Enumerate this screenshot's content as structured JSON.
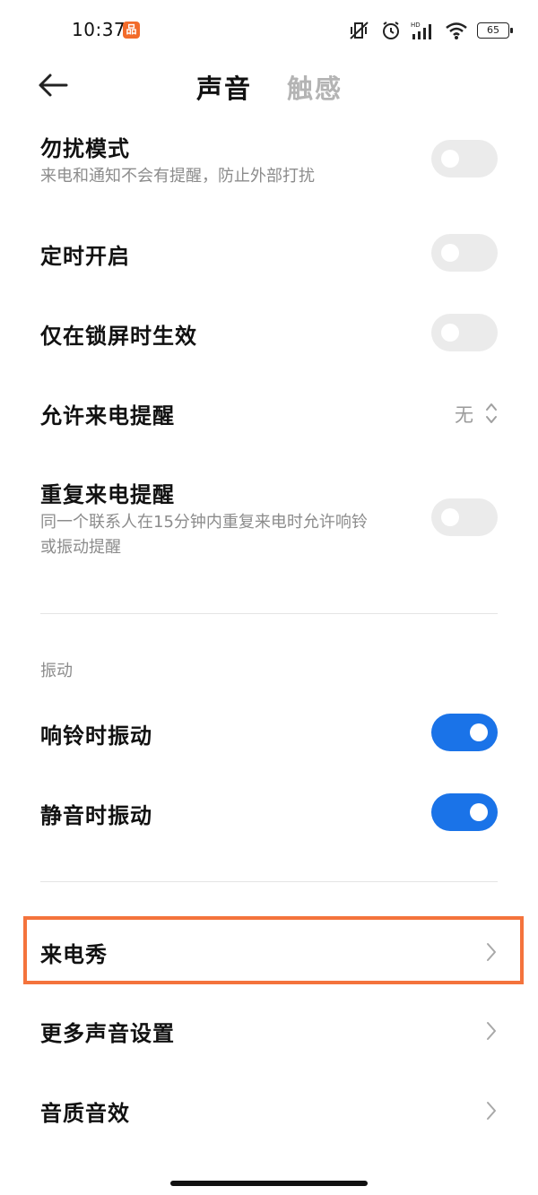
{
  "status_bar": {
    "time": "10:37",
    "app_badge": "品",
    "battery": "65",
    "icons": [
      "mute-vibrate-icon",
      "alarm-icon",
      "hd-signal-icon",
      "wifi-icon",
      "battery-icon"
    ]
  },
  "header": {
    "tab_active": "声音",
    "tab_inactive": "触感"
  },
  "dnd": {
    "title": "勿扰模式",
    "subtitle": "来电和通知不会有提醒，防止外部打扰",
    "enabled": false
  },
  "scheduled": {
    "title": "定时开启",
    "enabled": false
  },
  "lockscreen_only": {
    "title": "仅在锁屏时生效",
    "enabled": false
  },
  "allow_calls": {
    "title": "允许来电提醒",
    "value": "无"
  },
  "repeat_calls": {
    "title": "重复来电提醒",
    "subtitle_line1": "同一个联系人在15分钟内重复来电时允许响铃",
    "subtitle_line2": "或振动提醒",
    "enabled": false
  },
  "vibration_section": {
    "label": "振动",
    "ring_vibrate": {
      "title": "响铃时振动",
      "enabled": true
    },
    "silent_vibrate": {
      "title": "静音时振动",
      "enabled": true
    }
  },
  "nav_items": [
    {
      "title": "来电秀"
    },
    {
      "title": "更多声音设置"
    },
    {
      "title": "音质音效"
    }
  ],
  "colors": {
    "accent": "#1a73e8",
    "highlight": "#f4733c",
    "toggle_off": "#ebebeb"
  }
}
